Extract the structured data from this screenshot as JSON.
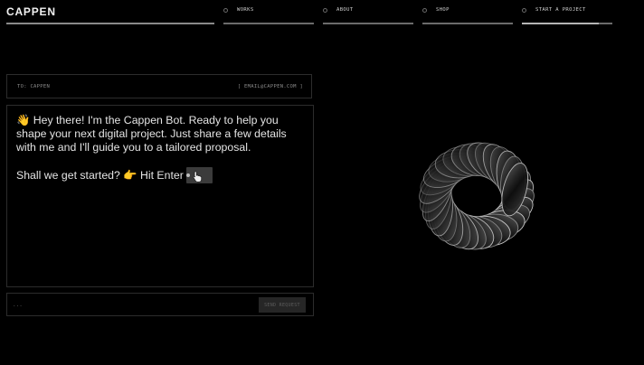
{
  "header": {
    "logo": "CAPPEN",
    "nav": [
      {
        "label": "WORKS"
      },
      {
        "label": "ABOUT"
      },
      {
        "label": "SHOP"
      },
      {
        "label": "START A PROJECT",
        "progress": 0.85
      }
    ]
  },
  "contact": {
    "to_label": "TO: CAPPEN",
    "email": "[ EMAIL@CAPPEN.COM ]"
  },
  "chat": {
    "lines": [
      "👋 Hey there! I'm the Cappen Bot. Ready to help you",
      "shape your next digital project. Just share a few details",
      "with me and I'll guide you to a tailored proposal."
    ],
    "cta": "Shall we get started? 👉 Hit Enter"
  },
  "input": {
    "placeholder": "...",
    "send_label": "SEND REQUEST"
  },
  "colors": {
    "background": "#000000",
    "text": "#e4e4e4",
    "border": "#2c2c2c"
  },
  "icons": {
    "cursor": "hand-pointer-icon",
    "nav_bullet": "circle-icon"
  }
}
